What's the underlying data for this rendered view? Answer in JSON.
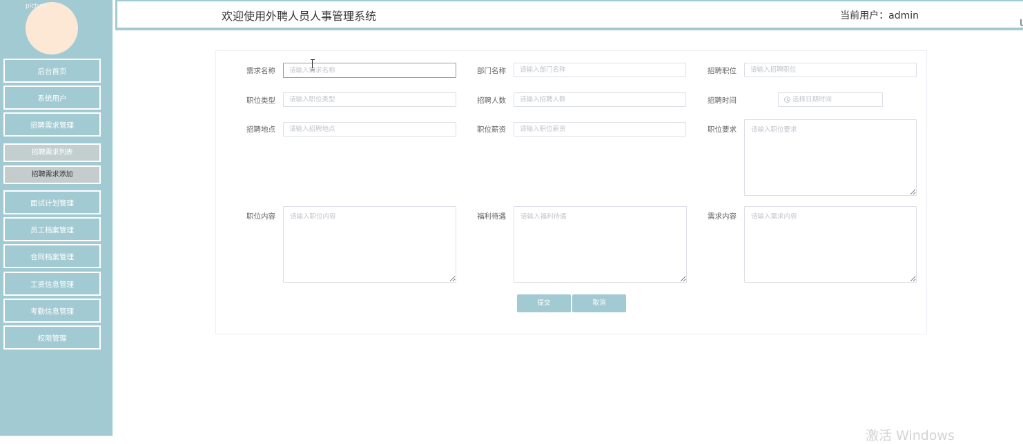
{
  "app": {
    "title": "欢迎使用外聘人员人事管理系统",
    "current_user": "当前用户：admin",
    "avatar_alt": "picture"
  },
  "sidebar": {
    "items": [
      {
        "label": "后台首页"
      },
      {
        "label": "系统用户"
      },
      {
        "label": "招聘需求管理"
      },
      {
        "label": "面试计划管理"
      },
      {
        "label": "员工档案管理"
      },
      {
        "label": "合同档案管理"
      },
      {
        "label": "工资信息管理"
      },
      {
        "label": "考勤信息管理"
      },
      {
        "label": "权限管理"
      }
    ],
    "subitems": [
      {
        "label": "招聘需求列表"
      },
      {
        "label": "招聘需求添加"
      }
    ]
  },
  "form": {
    "demand_name": {
      "label": "需求名称",
      "placeholder": "请输入需求名称"
    },
    "department_name": {
      "label": "部门名称",
      "placeholder": "请输入部门名称"
    },
    "recruit_position": {
      "label": "招聘职位",
      "placeholder": "请输入招聘职位"
    },
    "position_type": {
      "label": "职位类型",
      "placeholder": "请输入职位类型"
    },
    "recruit_count": {
      "label": "招聘人数",
      "placeholder": "请输入招聘人数"
    },
    "recruit_time": {
      "label": "招聘时间",
      "placeholder": "选择日期时间"
    },
    "recruit_location": {
      "label": "招聘地点",
      "placeholder": "请输入招聘地点"
    },
    "position_salary": {
      "label": "职位薪资",
      "placeholder": "请输入职位薪资"
    },
    "position_requirements": {
      "label": "职位要求",
      "placeholder": "请输入职位要求"
    },
    "position_content": {
      "label": "职位内容",
      "placeholder": "请输入职位内容"
    },
    "benefits": {
      "label": "福利待遇",
      "placeholder": "请输入福利待遇"
    },
    "demand_content": {
      "label": "需求内容",
      "placeholder": "请输入需求内容"
    },
    "submit_label": "提交",
    "cancel_label": "取消"
  },
  "watermark": "激活 Windows"
}
